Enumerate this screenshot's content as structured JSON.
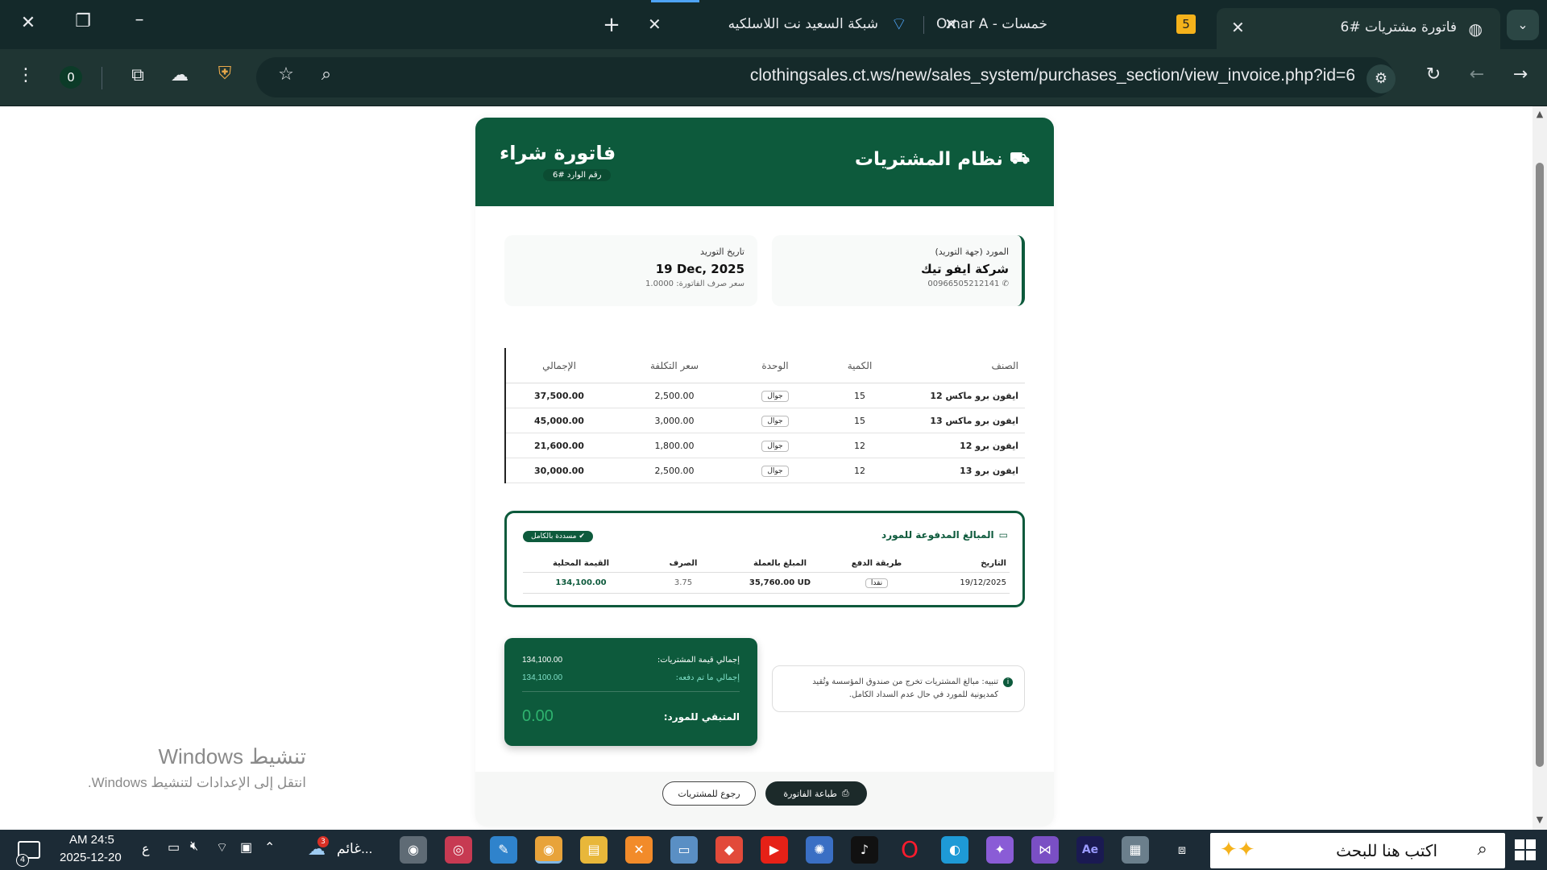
{
  "browser": {
    "tabs": [
      {
        "title": "فاتورة مشتريات #6",
        "active": true
      },
      {
        "title": "خمسات - Omar A",
        "badge": "5",
        "active": false
      },
      {
        "title": "شبكة السعيد نت اللاسلكيه",
        "active": false
      }
    ],
    "url": "clothingsales.ct.ws/new/sales_system/purchases_section/view_invoice.php?id=6",
    "extension_badge": "0"
  },
  "header": {
    "system_title": "نظام المشتريات",
    "invoice_title": "فاتورة شراء",
    "invoice_number": "رقم الوارد #6"
  },
  "supplier": {
    "label": "المورد (جهة التوريد)",
    "name": "شركة ايفو تيك",
    "phone": "00966505212141"
  },
  "supply_date": {
    "label": "تاريخ التوريد",
    "value": "19 Dec, 2025",
    "rate": "سعر صرف الفاتورة: 1.0000"
  },
  "items": {
    "headers": [
      "الصنف",
      "الكمية",
      "الوحدة",
      "سعر التكلفة",
      "الإجمالي"
    ],
    "rows": [
      {
        "name": "ايفون برو ماكس 12",
        "qty": "15",
        "unit": "جوال",
        "cost": "2,500.00",
        "total": "37,500.00"
      },
      {
        "name": "ايفون برو ماكس 13",
        "qty": "15",
        "unit": "جوال",
        "cost": "3,000.00",
        "total": "45,000.00"
      },
      {
        "name": "ايفون برو 12",
        "qty": "12",
        "unit": "جوال",
        "cost": "1,800.00",
        "total": "21,600.00"
      },
      {
        "name": "ايفون برو 13",
        "qty": "12",
        "unit": "جوال",
        "cost": "2,500.00",
        "total": "30,000.00"
      }
    ]
  },
  "payments": {
    "title": "المبالغ المدفوعة للمورد",
    "status_badge": "✔ مسددة بالكامل",
    "headers": [
      "التاريخ",
      "طريقة الدفع",
      "المبلغ بالعملة",
      "الصرف",
      "القيمة المحلية"
    ],
    "rows": [
      {
        "date": "19/12/2025",
        "method": "نقدا",
        "amount": "35,760.00 UD",
        "rate": "3.75",
        "local": "134,100.00"
      }
    ]
  },
  "summary": {
    "total_label": "إجمالي قيمة المشتريات:",
    "total_value": "134,100.00",
    "unpaid_label": "إجمالي ما تم دفعه:",
    "unpaid_value": "134,100.00",
    "remaining_label": "المتبقي للمورد:",
    "remaining_value": "0.00"
  },
  "note": "تنبيه: مبالغ المشتريات تخرج من صندوق المؤسسة وتُقيد كمديونية للمورد في حال عدم السداد الكامل.",
  "actions": {
    "print": "طباعة الفاتورة",
    "back": "رجوع للمشتريات"
  },
  "windows_activation": {
    "title": "تنشيط Windows",
    "subtitle": "انتقل إلى الإعدادات لتنشيط Windows."
  },
  "taskbar": {
    "time": "AM 24:5",
    "date": "2025-12-20",
    "lang": "ع",
    "notif_count": "4",
    "weather": "غائم...",
    "weather_badge": "3",
    "search_placeholder": "اكتب هنا للبحث"
  },
  "colors": {
    "brand": "#0d5a3c",
    "chrome_bg": "#14292a",
    "taskbar_bg": "#1c2b36"
  }
}
